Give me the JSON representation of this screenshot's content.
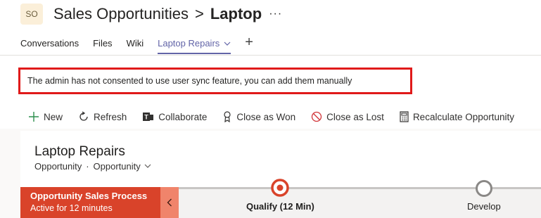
{
  "header": {
    "avatar_initials": "SO",
    "team_name": "Sales Opportunities",
    "separator": ">",
    "channel_name": "Laptop",
    "more": "···"
  },
  "tabs": [
    {
      "label": "Conversations"
    },
    {
      "label": "Files"
    },
    {
      "label": "Wiki"
    },
    {
      "label": "Laptop Repairs",
      "active": true
    }
  ],
  "tab_add": "+",
  "banner": {
    "message": "The admin has not consented to use user sync feature, you can add them manually"
  },
  "commands": {
    "new": "New",
    "refresh": "Refresh",
    "collaborate": "Collaborate",
    "close_won": "Close as Won",
    "close_lost": "Close as Lost",
    "recalculate": "Recalculate Opportunity"
  },
  "record": {
    "title": "Laptop Repairs",
    "entity": "Opportunity",
    "dot": "·",
    "form": "Opportunity"
  },
  "bpf": {
    "process_name": "Opportunity Sales Process",
    "active_for": "Active for 12 minutes",
    "stages": [
      {
        "label": "Qualify  (12 Min)",
        "active": true
      },
      {
        "label": "Develop",
        "active": false
      }
    ]
  },
  "colors": {
    "accent": "#6264a7",
    "banner_border": "#e01a1a",
    "bpf_stage": "#d9432a",
    "bpf_collapse": "#f0846b"
  }
}
